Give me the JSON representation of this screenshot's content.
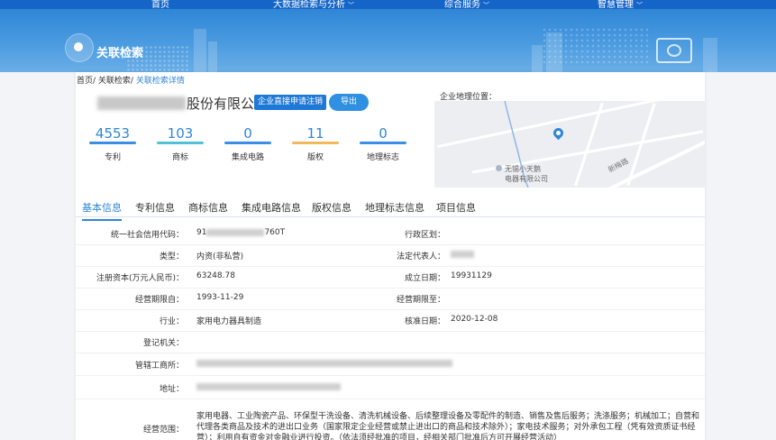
{
  "nav": {
    "home": "首页",
    "bigdata": "大数据检索与分析",
    "integrated": "综合服务",
    "smart": "智慧管理"
  },
  "banner": {
    "title": "关联检索"
  },
  "breadcrumb": {
    "home": "首页/",
    "search": "关联检索/",
    "current": "关联检索详情"
  },
  "company": {
    "name_suffix": "股份有限公司",
    "apply_button": "企业直接申请注销",
    "export_button": "导出"
  },
  "stats": [
    {
      "value": "4553",
      "label": "专利",
      "color": "#3a8ee6"
    },
    {
      "value": "103",
      "label": "商标",
      "color": "#4fc2d8"
    },
    {
      "value": "0",
      "label": "集成电路",
      "color": "#3a8ee6"
    },
    {
      "value": "11",
      "label": "版权",
      "color": "#f2b85c"
    },
    {
      "value": "0",
      "label": "地理标志",
      "color": "#3a8ee6"
    }
  ],
  "map": {
    "label": "企业地理位置：",
    "poi_line1": "无锡小天鹅",
    "poi_line2": "电器有限公司",
    "road_name": "新梅路"
  },
  "tabs": [
    "基本信息",
    "专利信息",
    "商标信息",
    "集成电路信息",
    "版权信息",
    "地理标志信息",
    "项目信息"
  ],
  "info": {
    "credit_code_label": "统一社会信用代码：",
    "credit_code_prefix": "91",
    "credit_code_suffix": "760T",
    "region_label": "行政区划：",
    "type_label": "类型：",
    "type_value": "内资(非私营)",
    "legal_rep_label": "法定代表人：",
    "capital_label": "注册资本(万元人民币)：",
    "capital_value": "63248.78",
    "established_label": "成立日期：",
    "established_value": "19931129",
    "term_from_label": "经营期限自：",
    "term_from_value": "1993-11-29",
    "term_to_label": "经营期限至：",
    "industry_label": "行业：",
    "industry_value": "家用电力器具制造",
    "approved_label": "核准日期：",
    "approved_value": "2020-12-08",
    "authority_label": "登记机关：",
    "bureau_label": "管辖工商所：",
    "address_label": "地址：",
    "scope_label": "经营范围：",
    "scope_value": "家用电器、工业陶瓷产品、环保型干洗设备、清洗机械设备、后续整理设备及零配件的制造、销售及售后服务；洗涤服务；机械加工；自营和代理各类商品及技术的进出口业务（国家限定企业经营或禁止进出口的商品和技术除外）；家电技术服务；对外承包工程（凭有效资质证书经营）；利用自有资金对金融业进行投资。（依法须经批准的项目，经相关部门批准后方可开展经营活动）"
  }
}
